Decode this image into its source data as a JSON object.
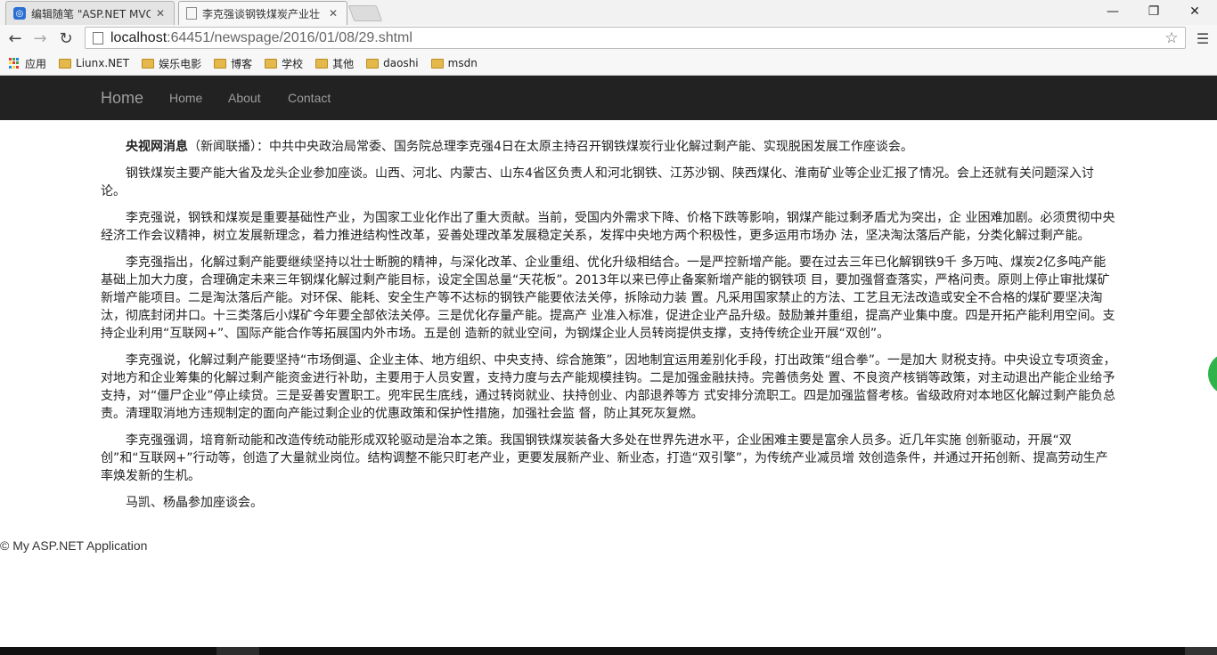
{
  "browser": {
    "tabs": [
      {
        "title": "编辑随笔 \"ASP.NET MVC",
        "icon": "cnblogs-icon"
      },
      {
        "title": "李克强谈钢铁煤炭产业壮",
        "icon": "page-icon"
      }
    ],
    "address": {
      "scheme_host": "localhost",
      "rest": ":64451/newspage/2016/01/08/29.shtml"
    },
    "bookmarks": [
      {
        "label": "应用",
        "icon": "apps-icon"
      },
      {
        "label": "Liunx.NET",
        "icon": "folder-icon"
      },
      {
        "label": "娱乐电影",
        "icon": "folder-icon"
      },
      {
        "label": "博客",
        "icon": "folder-icon"
      },
      {
        "label": "学校",
        "icon": "folder-icon"
      },
      {
        "label": "其他",
        "icon": "folder-icon"
      },
      {
        "label": "daoshi",
        "icon": "folder-icon"
      },
      {
        "label": "msdn",
        "icon": "folder-icon"
      }
    ]
  },
  "site": {
    "brand": "Home",
    "nav": [
      "Home",
      "About",
      "Contact"
    ],
    "footer": "© My ASP.NET Application"
  },
  "article": {
    "lead_source": "央视网消息",
    "lead_rest": "（新闻联播）：中共中央政治局常委、国务院总理李克强4日在太原主持召开钢铁煤炭行业化解过剩产能、实现脱困发展工作座谈会。",
    "paragraphs": [
      "钢铁煤炭主要产能大省及龙头企业参加座谈。山西、河北、内蒙古、山东4省区负责人和河北钢铁、江苏沙钢、陕西煤化、淮南矿业等企业汇报了情况。会上还就有关问题深入讨论。",
      "李克强说，钢铁和煤炭是重要基础性产业，为国家工业化作出了重大贡献。当前，受国内外需求下降、价格下跌等影响，钢煤产能过剩矛盾尤为突出，企 业困难加剧。必须贯彻中央经济工作会议精神，树立发展新理念，着力推进结构性改革，妥善处理改革发展稳定关系，发挥中央地方两个积极性，更多运用市场办 法，坚决淘汰落后产能，分类化解过剩产能。",
      "李克强指出，化解过剩产能要继续坚持以壮士断腕的精神，与深化改革、企业重组、优化升级相结合。一是严控新增产能。要在过去三年已化解钢铁9千 多万吨、煤炭2亿多吨产能基础上加大力度，合理确定未来三年钢煤化解过剩产能目标，设定全国总量“天花板”。2013年以来已停止备案新增产能的钢铁项 目，要加强督查落实，严格问责。原则上停止审批煤矿新增产能项目。二是淘汰落后产能。对环保、能耗、安全生产等不达标的钢铁产能要依法关停，拆除动力装 置。凡采用国家禁止的方法、工艺且无法改造或安全不合格的煤矿要坚决淘汰，彻底封闭井口。十三类落后小煤矿今年要全部依法关停。三是优化存量产能。提高产 业准入标准，促进企业产品升级。鼓励兼并重组，提高产业集中度。四是开拓产能利用空间。支持企业利用“互联网+”、国际产能合作等拓展国内外市场。五是创 造新的就业空间，为钢煤企业人员转岗提供支撑，支持传统企业开展“双创”。",
      "李克强说，化解过剩产能要坚持“市场倒逼、企业主体、地方组织、中央支持、综合施策”，因地制宜运用差别化手段，打出政策“组合拳”。一是加大 财税支持。中央设立专项资金，对地方和企业筹集的化解过剩产能资金进行补助，主要用于人员安置，支持力度与去产能规模挂钩。二是加强金融扶持。完善债务处 置、不良资产核销等政策，对主动退出产能企业给予支持，对“僵尸企业”停止续贷。三是妥善安置职工。兜牢民生底线，通过转岗就业、扶持创业、内部退养等方 式安排分流职工。四是加强监督考核。省级政府对本地区化解过剩产能负总责。清理取消地方违规制定的面向产能过剩企业的优惠政策和保护性措施，加强社会监 督，防止其死灰复燃。",
      "李克强强调，培育新动能和改造传统动能形成双轮驱动是治本之策。我国钢铁煤炭装备大多处在世界先进水平，企业困难主要是富余人员多。近几年实施 创新驱动，开展“双创”和“互联网+”行动等，创造了大量就业岗位。结构调整不能只盯老产业，更要发展新产业、新业态，打造“双引擎”，为传统产业减员增 效创造条件，并通过开拓创新、提高劳动生产率焕发新的生机。",
      "马凯、杨晶参加座谈会。"
    ]
  }
}
